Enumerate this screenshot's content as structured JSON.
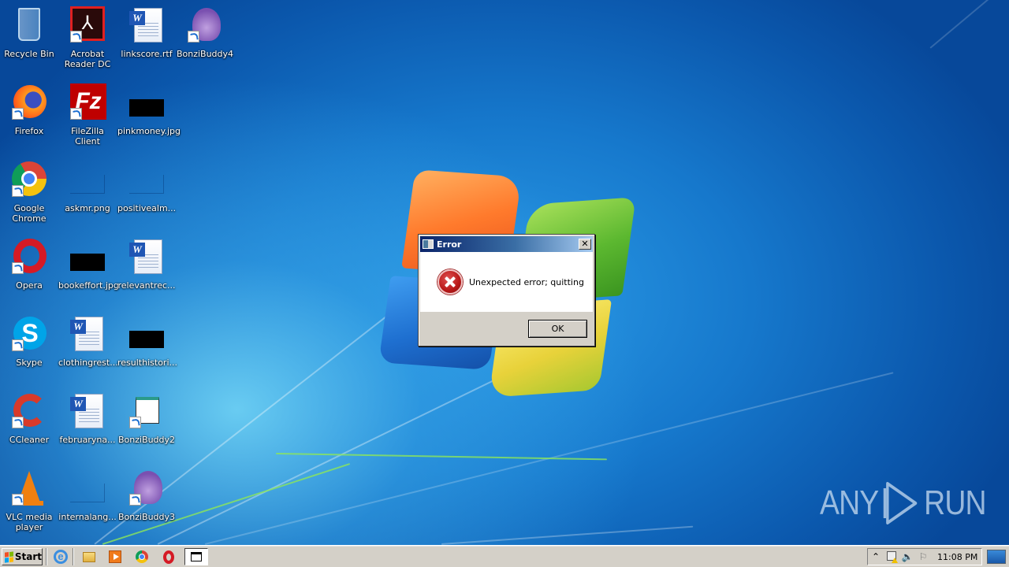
{
  "desktop": {
    "icons": [
      {
        "label": "Recycle Bin",
        "type": "recycle-bin"
      },
      {
        "label": "Acrobat Reader DC",
        "type": "acrobat"
      },
      {
        "label": "linkscore.rtf",
        "type": "word-doc"
      },
      {
        "label": "BonziBuddy4",
        "type": "bonzi"
      },
      {
        "label": "Firefox",
        "type": "firefox"
      },
      {
        "label": "FileZilla Client",
        "type": "filezilla"
      },
      {
        "label": "pinkmoney.jpg",
        "type": "image-black"
      },
      {
        "label": "Google Chrome",
        "type": "chrome"
      },
      {
        "label": "askmr.png",
        "type": "image-blank"
      },
      {
        "label": "positivealm...",
        "type": "image-blank"
      },
      {
        "label": "Opera",
        "type": "opera"
      },
      {
        "label": "bookeffort.jpg",
        "type": "image-black"
      },
      {
        "label": "relevantrec...",
        "type": "word-doc"
      },
      {
        "label": "Skype",
        "type": "skype"
      },
      {
        "label": "clothingrest...",
        "type": "word-doc"
      },
      {
        "label": "resulthistori...",
        "type": "image-black"
      },
      {
        "label": "CCleaner",
        "type": "ccleaner"
      },
      {
        "label": "februaryna...",
        "type": "word-doc"
      },
      {
        "label": "BonziBuddy2",
        "type": "window-app"
      },
      {
        "label": "VLC media player",
        "type": "vlc"
      },
      {
        "label": "internalang...",
        "type": "image-blank"
      },
      {
        "label": "BonziBuddy3",
        "type": "bonzi"
      }
    ]
  },
  "dialog": {
    "title": "Error",
    "message": "Unexpected error; quitting",
    "ok_label": "OK",
    "close_label": "✕",
    "icon": "error-icon"
  },
  "watermark": {
    "left": "ANY",
    "right": "RUN"
  },
  "taskbar": {
    "start_label": "Start",
    "quick_launch": [
      "internet-explorer-icon",
      "folder-icon",
      "media-player-icon",
      "chrome-icon",
      "opera-icon"
    ],
    "active_task_icon": "window-app-icon",
    "tray": {
      "icons": [
        "show-hidden-icons",
        "network-warning-icon",
        "volume-icon",
        "action-center-flag-icon"
      ],
      "clock": "11:08 PM"
    }
  },
  "colors": {
    "taskbar_bg": "#d4d0c8",
    "dialog_title_start": "#0a246a",
    "dialog_title_end": "#a6caf0",
    "error_red": "#b81818"
  }
}
